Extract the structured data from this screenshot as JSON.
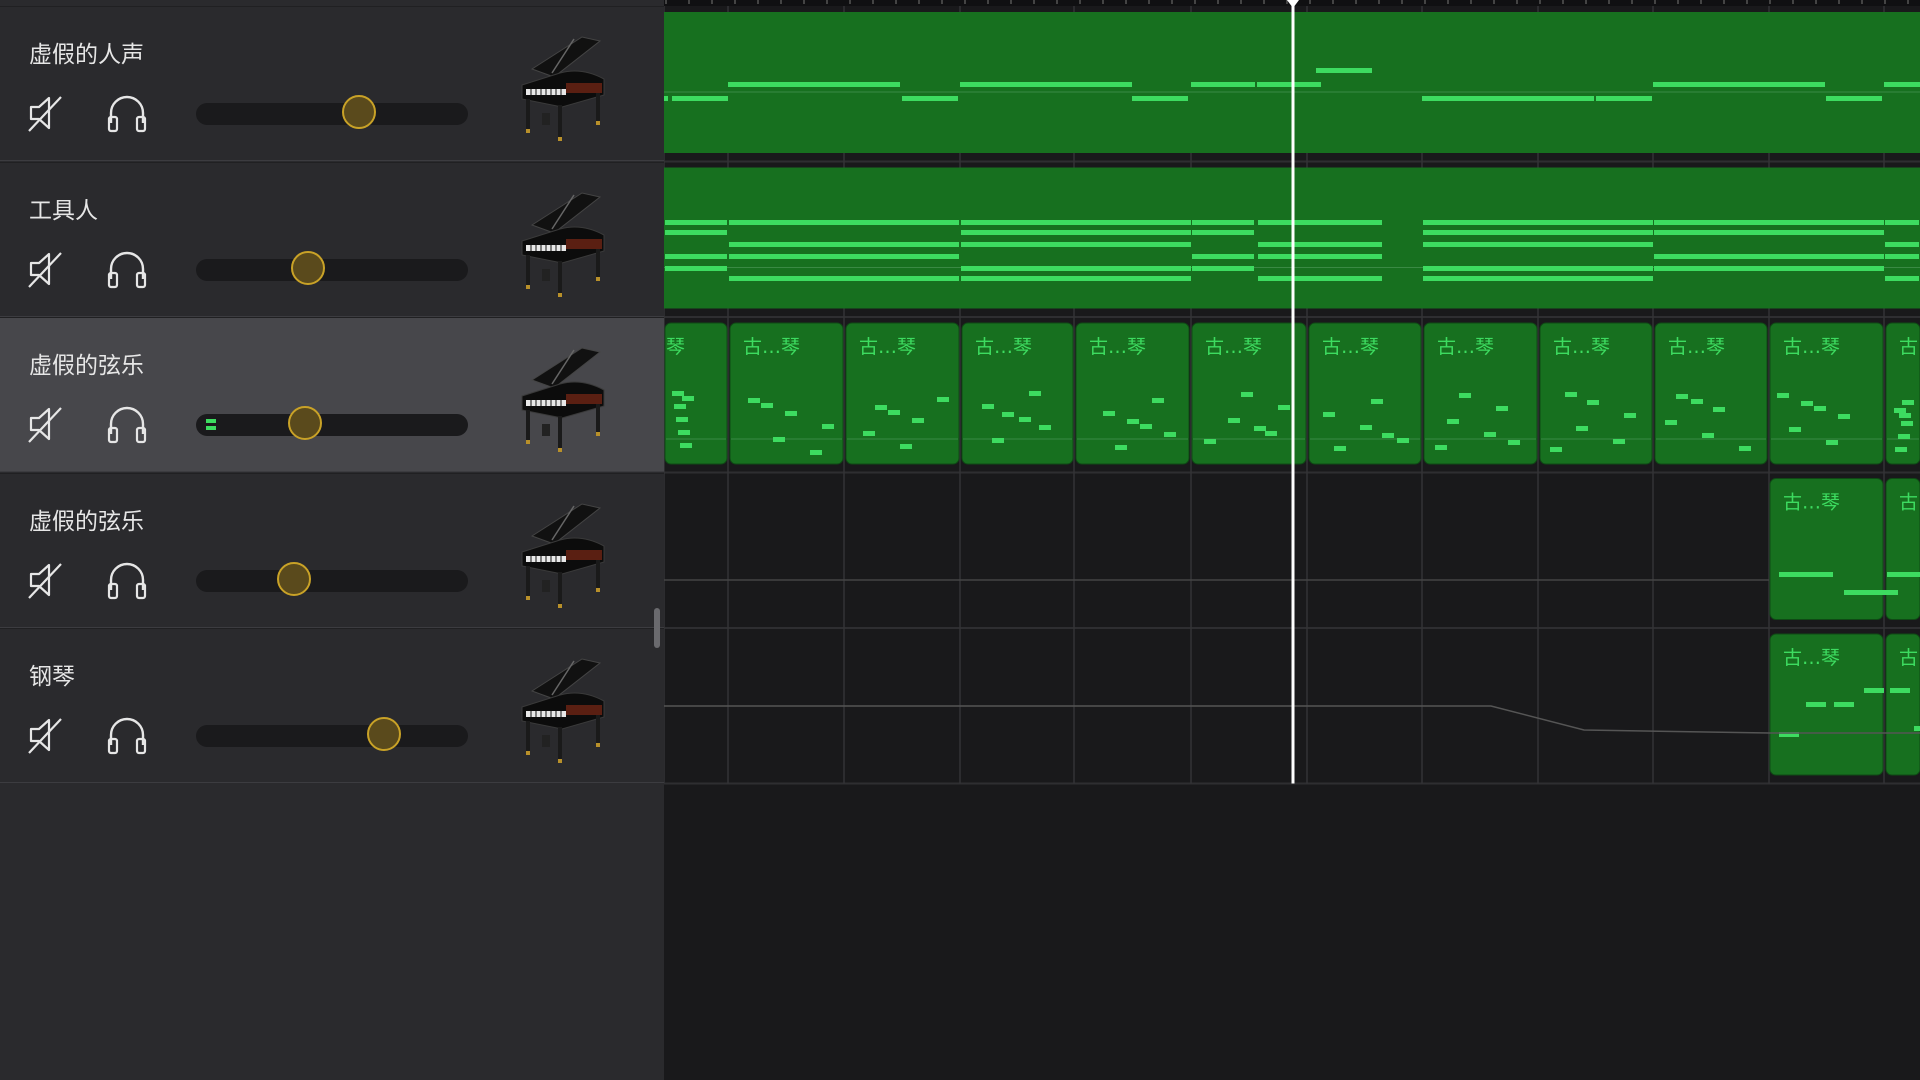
{
  "tracks": [
    {
      "name": "虚假的人声",
      "volume": 0.6,
      "selected": false
    },
    {
      "name": "工具人",
      "volume": 0.41,
      "selected": false
    },
    {
      "name": "虚假的弦乐",
      "volume": 0.4,
      "selected": true
    },
    {
      "name": "虚假的弦乐",
      "volume": 0.36,
      "selected": false
    },
    {
      "name": "钢琴",
      "volume": 0.69,
      "selected": false
    }
  ],
  "region_label": "古…琴",
  "colors": {
    "region_fill": "#17701f",
    "note": "#3ddc60",
    "panel_bg": "#2a2a2d",
    "selected_bg": "#47474b",
    "timeline_bg": "#19191b",
    "volume_thumb": "#c9a227"
  },
  "icons": {
    "mute": "speaker-muted-icon",
    "solo": "headphones-icon",
    "instrument": "grand-piano-icon",
    "playhead": "playhead-icon"
  }
}
